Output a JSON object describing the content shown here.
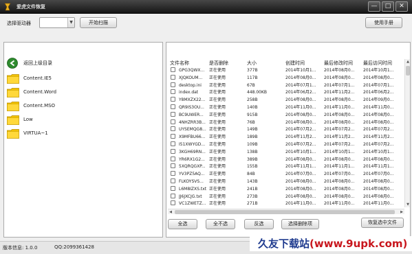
{
  "window": {
    "title": "爱虎文件恢复",
    "icon": "app-logo-icon",
    "controls": {
      "minimize": "—",
      "maximize": "□",
      "close": "✕"
    }
  },
  "toolbar": {
    "drive_label": "选择驱动器",
    "drive_value": "",
    "scan_button": "开始扫描",
    "manual_button": "使用手册"
  },
  "folders": {
    "back_label": "返回上级目录",
    "items": [
      "Content.IE5",
      "Content.Word",
      "Content.MSO",
      "Low",
      "VIRTUA~1"
    ]
  },
  "file_table": {
    "columns": [
      "文件名称",
      "是否删除",
      "大小",
      "创建时间",
      "最后修改时间",
      "最后访问时间"
    ],
    "rows": [
      {
        "name": "GPG3QWX...",
        "deleted": "正在使用",
        "size": "377B",
        "created": "2014年10月1...",
        "modified": "2014年08月0...",
        "accessed": "2014年10月1..."
      },
      {
        "name": "XJQKOUM...",
        "deleted": "正在使用",
        "size": "117B",
        "created": "2014年08月0...",
        "modified": "2014年08月0...",
        "accessed": "2014年08月0..."
      },
      {
        "name": "desktop.ini",
        "deleted": "正在使用",
        "size": "67B",
        "created": "2014年07月1...",
        "modified": "2014年07月1...",
        "accessed": "2014年07月1..."
      },
      {
        "name": "index.dat",
        "deleted": "正在使用",
        "size": "448.00KB",
        "created": "2014年06月2...",
        "modified": "2014年11月2...",
        "accessed": "2014年06月2..."
      },
      {
        "name": "Y8MXZX22...",
        "deleted": "正在使用",
        "size": "258B",
        "created": "2014年08月0...",
        "modified": "2014年08月0...",
        "accessed": "2014年09月0..."
      },
      {
        "name": "QR9IS3OU...",
        "deleted": "正在使用",
        "size": "140B",
        "created": "2014年11月0...",
        "modified": "2014年11月0...",
        "accessed": "2014年11月0..."
      },
      {
        "name": "BC9UWER...",
        "deleted": "正在使用",
        "size": "915B",
        "created": "2014年08月0...",
        "modified": "2014年08月0...",
        "accessed": "2014年08月0..."
      },
      {
        "name": "4NHZRR3B...",
        "deleted": "正在使用",
        "size": "76B",
        "created": "2014年08月0...",
        "modified": "2014年08月0...",
        "accessed": "2014年08月0..."
      },
      {
        "name": "UYSEMQG8...",
        "deleted": "正在使用",
        "size": "149B",
        "created": "2014年07月2...",
        "modified": "2014年07月2...",
        "accessed": "2014年07月2..."
      },
      {
        "name": "X9MFBU66...",
        "deleted": "正在使用",
        "size": "189B",
        "created": "2014年11月2...",
        "modified": "2014年11月2...",
        "accessed": "2014年11月2..."
      },
      {
        "name": "I51XWYGD...",
        "deleted": "正在使用",
        "size": "109B",
        "created": "2014年07月2...",
        "modified": "2014年07月2...",
        "accessed": "2014年07月2..."
      },
      {
        "name": "3KGH69RN...",
        "deleted": "正在使用",
        "size": "138B",
        "created": "2014年10月1...",
        "modified": "2014年10月1...",
        "accessed": "2014年10月1..."
      },
      {
        "name": "YR6RX1G2...",
        "deleted": "正在使用",
        "size": "389B",
        "created": "2014年08月0...",
        "modified": "2014年08月0...",
        "accessed": "2014年08月0..."
      },
      {
        "name": "5XQRQGXP...",
        "deleted": "正在使用",
        "size": "155B",
        "created": "2014年11月1...",
        "modified": "2014年11月1...",
        "accessed": "2014年11月1..."
      },
      {
        "name": "YV3PZ5AQ...",
        "deleted": "正在使用",
        "size": "84B",
        "created": "2014年07月0...",
        "modified": "2014年07月0...",
        "accessed": "2014年07月0..."
      },
      {
        "name": "FLKOYSVS...",
        "deleted": "正在使用",
        "size": "143B",
        "created": "2014年08月0...",
        "modified": "2014年08月0...",
        "accessed": "2014年08月0..."
      },
      {
        "name": "L6M8IZXS.txt",
        "deleted": "正在使用",
        "size": "241B",
        "created": "2014年08月0...",
        "modified": "2014年08月0...",
        "accessed": "2014年08月0..."
      },
      {
        "name": "JJ6JXCJG.txt",
        "deleted": "正在使用",
        "size": "273B",
        "created": "2014年08月0...",
        "modified": "2014年08月0...",
        "accessed": "2014年08月0..."
      },
      {
        "name": "VC1ZWETZ...",
        "deleted": "正在使用",
        "size": "271B",
        "created": "2014年11月0...",
        "modified": "2014年11月0...",
        "accessed": "2014年11月0..."
      }
    ]
  },
  "actions": {
    "select_all": "全选",
    "select_none": "全不选",
    "invert": "反选",
    "select_deleted": "选择删除项",
    "recover": "恢复选中文件"
  },
  "status": {
    "version": "版本信息: 1.0.0",
    "qq": "QQ:2099361428"
  },
  "watermark": {
    "brand": "久友下载站",
    "url": "(www.9upk.com)"
  },
  "colors": {
    "titlebar": "#1f1f1f",
    "folder": "#f2c200",
    "back_button": "#2e8b2e",
    "watermark_blue": "#1f3b8f",
    "watermark_red": "#c8161d"
  }
}
